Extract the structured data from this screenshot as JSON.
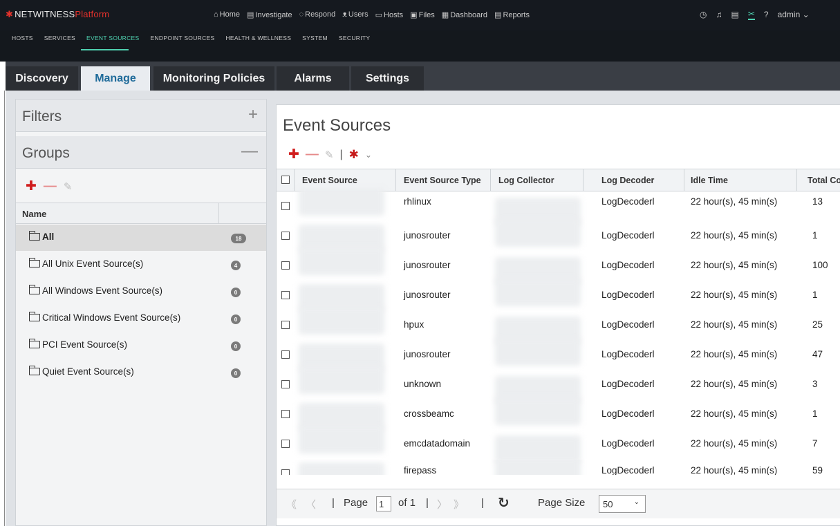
{
  "header": {
    "brand": "NETWITNESS",
    "brand_suffix": "Platform",
    "main_nav": [
      {
        "label": "Home",
        "icon": "home-icon",
        "glyph": "⌂"
      },
      {
        "label": "Investigate",
        "icon": "investigate-icon",
        "glyph": "▤"
      },
      {
        "label": "Respond",
        "icon": "respond-icon",
        "glyph": "◌"
      },
      {
        "label": "Users",
        "icon": "users-icon",
        "glyph": "ᴥ"
      },
      {
        "label": "Hosts",
        "icon": "hosts-icon",
        "glyph": "▭"
      },
      {
        "label": "Files",
        "icon": "files-icon",
        "glyph": "▣"
      },
      {
        "label": "Dashboard",
        "icon": "dashboard-icon",
        "glyph": "▦"
      },
      {
        "label": "Reports",
        "icon": "reports-icon",
        "glyph": "▤"
      }
    ],
    "user": "admin"
  },
  "subnav": {
    "items": [
      "HOSTS",
      "SERVICES",
      "EVENT SOURCES",
      "ENDPOINT SOURCES",
      "HEALTH & WELLNESS",
      "SYSTEM",
      "SECURITY"
    ],
    "active": "EVENT SOURCES"
  },
  "tabs": [
    "Discovery",
    "Manage",
    "Monitoring Policies",
    "Alarms",
    "Settings"
  ],
  "active_tab": "Manage",
  "left_panel": {
    "filters_title": "Filters",
    "groups_title": "Groups",
    "column_name": "Name",
    "groups": [
      {
        "name": "All",
        "count": "18"
      },
      {
        "name": "All Unix Event Source(s)",
        "count": "4"
      },
      {
        "name": "All Windows Event Source(s)",
        "count": "0"
      },
      {
        "name": "Critical Windows Event Source(s)",
        "count": "0"
      },
      {
        "name": "PCI Event Source(s)",
        "count": "0"
      },
      {
        "name": "Quiet Event Source(s)",
        "count": "0"
      }
    ]
  },
  "main": {
    "title": "Event Sources",
    "columns": [
      "Event Source",
      "Event Source Type",
      "Log Collector",
      "Log Decoder",
      "Idle Time",
      "Total Co"
    ],
    "rows": [
      {
        "type": "rhlinux",
        "decoder": "LogDecoderl",
        "idle": "22 hour(s), 45 min(s)",
        "total": "13"
      },
      {
        "type": "junosrouter",
        "decoder": "LogDecoderl",
        "idle": "22 hour(s), 45 min(s)",
        "total": "1"
      },
      {
        "type": "junosrouter",
        "decoder": "LogDecoderl",
        "idle": "22 hour(s), 45 min(s)",
        "total": "100"
      },
      {
        "type": "junosrouter",
        "decoder": "LogDecoderl",
        "idle": "22 hour(s), 45 min(s)",
        "total": "1"
      },
      {
        "type": "hpux",
        "decoder": "LogDecoderl",
        "idle": "22 hour(s), 45 min(s)",
        "total": "25"
      },
      {
        "type": "junosrouter",
        "decoder": "LogDecoderl",
        "idle": "22 hour(s), 45 min(s)",
        "total": "47"
      },
      {
        "type": "unknown",
        "decoder": "LogDecoderl",
        "idle": "22 hour(s), 45 min(s)",
        "total": "3"
      },
      {
        "type": "crossbeamc",
        "decoder": "LogDecoderl",
        "idle": "22 hour(s), 45 min(s)",
        "total": "1"
      },
      {
        "type": "emcdatadomain",
        "decoder": "LogDecoderl",
        "idle": "22 hour(s), 45 min(s)",
        "total": "7"
      },
      {
        "type": "firepass",
        "decoder": "LogDecoderl",
        "idle": "22 hour(s), 45 min(s)",
        "total": "59"
      }
    ]
  },
  "pager": {
    "page_label": "Page",
    "page_value": "1",
    "of_label": "of 1",
    "page_size_label": "Page Size",
    "page_size_value": "50"
  },
  "colors": {
    "accent": "#4fd1b0",
    "brand_red": "#e5322c",
    "active_tab_text": "#1f6b9a"
  }
}
